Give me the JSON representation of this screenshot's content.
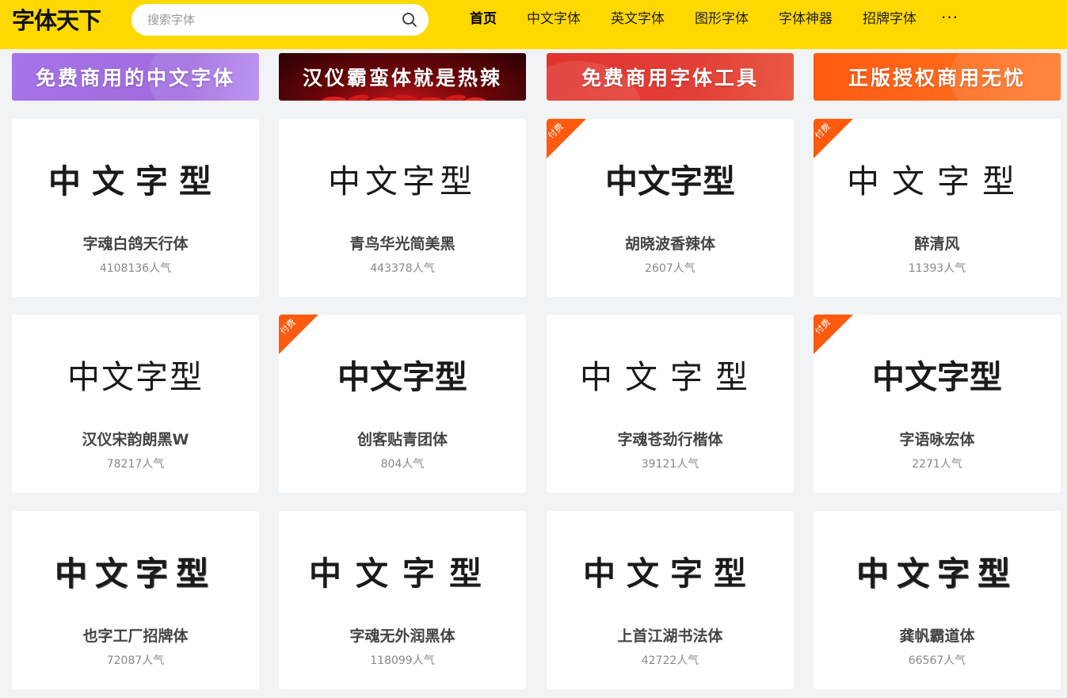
{
  "header": {
    "logo": "字体天下",
    "search_placeholder": "搜索字体",
    "nav": [
      {
        "label": "首页",
        "active": true
      },
      {
        "label": "中文字体"
      },
      {
        "label": "英文字体"
      },
      {
        "label": "图形字体"
      },
      {
        "label": "字体神器"
      },
      {
        "label": "招牌字体"
      }
    ],
    "more": "···"
  },
  "banners": [
    {
      "text": "免费商用的中文字体"
    },
    {
      "text": "汉仪霸蛮体就是热辣"
    },
    {
      "text": "免费商用字体工具"
    },
    {
      "text": "正版授权商用无忧"
    }
  ],
  "paid_badge": "付费",
  "fonts": [
    {
      "preview": "中文字型",
      "name": "字魂白鸽天行体",
      "popularity": "4108136人气",
      "paid": false
    },
    {
      "preview": "中文字型",
      "name": "青鸟华光简美黑",
      "popularity": "443378人气",
      "paid": false
    },
    {
      "preview": "中文字型",
      "name": "胡晓波香辣体",
      "popularity": "2607人气",
      "paid": true
    },
    {
      "preview": "中文字型",
      "name": "醉清风",
      "popularity": "11393人气",
      "paid": true
    },
    {
      "preview": "中文字型",
      "name": "汉仪宋韵朗黑W",
      "popularity": "78217人气",
      "paid": false
    },
    {
      "preview": "中文字型",
      "name": "创客贴青团体",
      "popularity": "804人气",
      "paid": true
    },
    {
      "preview": "中文字型",
      "name": "字魂苍劲行楷体",
      "popularity": "39121人气",
      "paid": false
    },
    {
      "preview": "中文字型",
      "name": "字语咏宏体",
      "popularity": "2271人气",
      "paid": true
    },
    {
      "preview": "中文字型",
      "name": "也字工厂招牌体",
      "popularity": "72087人气",
      "paid": false
    },
    {
      "preview": "中文字型",
      "name": "字魂无外润黑体",
      "popularity": "118099人气",
      "paid": false
    },
    {
      "preview": "中文字型",
      "name": "上首江湖书法体",
      "popularity": "42722人气",
      "paid": false
    },
    {
      "preview": "中文字型",
      "name": "龚帆霸道体",
      "popularity": "66567人气",
      "paid": false
    }
  ],
  "colors": {
    "header_bg": "#ffd800",
    "paid_ribbon": "#ff5a0f",
    "page_bg": "#f2f3f5"
  }
}
